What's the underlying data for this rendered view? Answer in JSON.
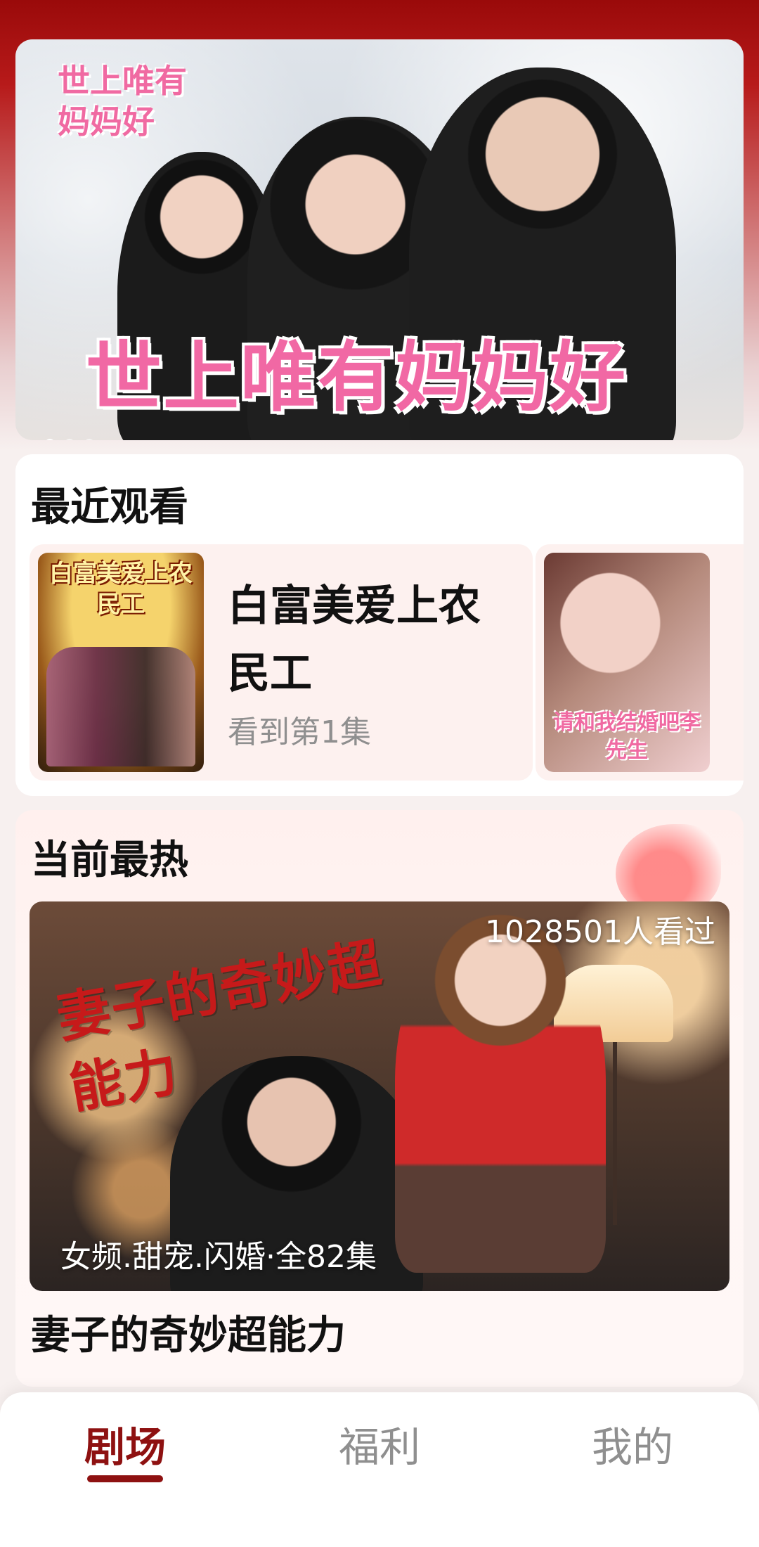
{
  "banner": {
    "title_small": "世上唯有妈妈好",
    "title_big": "世上唯有妈妈好",
    "slide_count": 3,
    "active_slide": 1
  },
  "recent": {
    "section_title": "最近观看",
    "items": [
      {
        "poster_text": "白富美爱上农民工",
        "name": "白富美爱上农民工",
        "progress": "看到第1集"
      },
      {
        "poster_text": "请和我结婚吧李先生",
        "name": "",
        "progress": ""
      }
    ]
  },
  "hot": {
    "section_title": "当前最热",
    "poster_title": "妻子的奇妙超能力",
    "views": "1028501人看过",
    "tags": "女频.甜宠.闪婚·全82集",
    "name": "妻子的奇妙超能力"
  },
  "nav": {
    "items": [
      {
        "label": "剧场",
        "active": true
      },
      {
        "label": "福利",
        "active": false
      },
      {
        "label": "我的",
        "active": false
      }
    ]
  },
  "colors": {
    "header_red": "#9a0a0a",
    "accent_red": "#8e1111",
    "pink_title": "#f168a4",
    "inactive_gray": "#8f8f8f"
  }
}
